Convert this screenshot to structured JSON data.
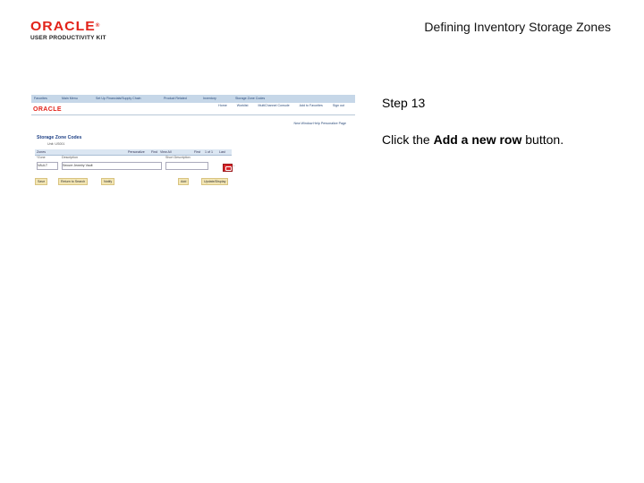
{
  "header": {
    "brand": "ORACLE",
    "brand_mark": "®",
    "brand_sub": "USER PRODUCTIVITY KIT",
    "doc_title": "Defining Inventory Storage Zones"
  },
  "step": {
    "label": "Step 13",
    "instruction_pre": "Click the ",
    "instruction_bold": "Add a new row",
    "instruction_post": " button."
  },
  "screenshot": {
    "breadcrumb": [
      "Favorites",
      "Main Menu",
      "Set Up Financials/Supply Chain",
      "Product Related",
      "Inventory",
      "Storage Zone Codes"
    ],
    "brand": "ORACLE",
    "top_links": [
      "Home",
      "Worklist",
      "MultiChannel Console",
      "Add to Favorites",
      "Sign out"
    ],
    "right_links": "New Window   Help   Personalize Page",
    "page_title": "Storage Zone Codes",
    "unit": "Unit: US001",
    "grid_header": [
      "Zones",
      "Personalize",
      "Find",
      "View All",
      "First",
      "1 of 1",
      "Last"
    ],
    "columns": [
      "*Zone",
      "Description",
      "Short Description"
    ],
    "row": [
      "VAULT",
      "Secure Jewelry Vault",
      ""
    ],
    "bottom_buttons": [
      "Save",
      "Return to Search",
      "Notify",
      "Add",
      "Update/Display"
    ]
  }
}
